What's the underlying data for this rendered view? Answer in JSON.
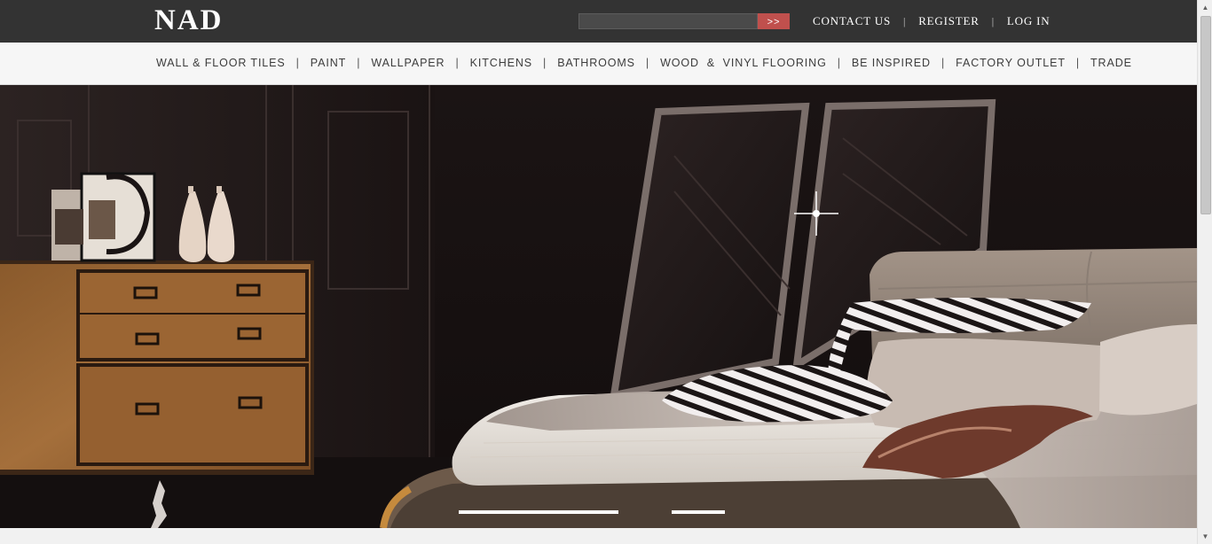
{
  "header": {
    "logo": "NAD",
    "search": {
      "value": "",
      "placeholder": "",
      "button_label": ">>"
    },
    "links": [
      {
        "label": "CONTACT US"
      },
      {
        "label": "REGISTER"
      },
      {
        "label": "LOG IN"
      }
    ],
    "separator": "|"
  },
  "nav": {
    "items": [
      {
        "label": "WALL & FLOOR TILES"
      },
      {
        "label": "PAINT"
      },
      {
        "label": "WALLPAPER"
      },
      {
        "label": "KITCHENS"
      },
      {
        "label": "BATHROOMS"
      },
      {
        "label": "WOOD  &  VINYL FLOORING"
      },
      {
        "label": "BE INSPIRED"
      },
      {
        "label": "FACTORY OUTLET"
      },
      {
        "label": "TRADE"
      }
    ],
    "separator": "|"
  },
  "hero": {
    "slides": [
      {
        "state": "active"
      },
      {
        "state": "inactive"
      }
    ]
  },
  "colors": {
    "topbar": "#333333",
    "search_button": "#c0504d",
    "navbar": "#f6f6f6"
  },
  "icons": {
    "scroll_up": "arrow-up-icon",
    "scroll_down": "arrow-down-icon"
  }
}
